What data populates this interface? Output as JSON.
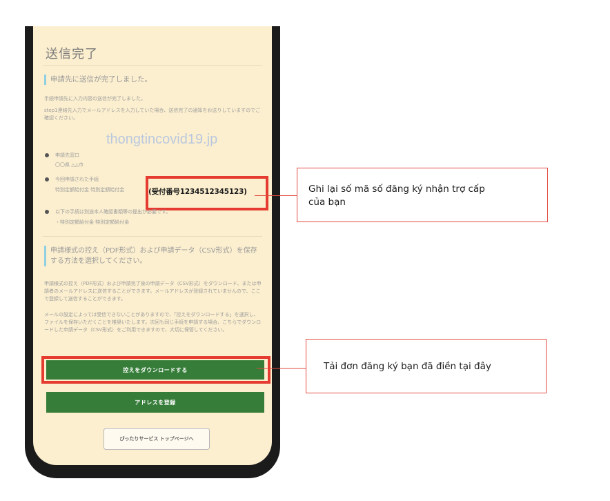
{
  "phone_screen": {
    "title": "送信完了",
    "section1_heading": "申請先に送信が完了しました。",
    "intro_line1": "手続申請先に入力内容の送信が完了しました。",
    "intro_line2": "step1連絡先入力でメールアドレスを入力していた場合、送信完了の通知をお送りしていますのでご確認ください。",
    "watermark": "thongtincovid19.jp",
    "bullets": [
      {
        "line1": "申請先窓口",
        "line2": "〇〇県 △△市"
      },
      {
        "line1": "今回申請された手続",
        "line2": "特別定額給付金 特別定額給付金"
      },
      {
        "line1": "以下の手続は別途本人確認書類等の提出が必要です。",
        "line2": "・特別定額給付金 特別定額給付金"
      }
    ],
    "receipt_number": "(受付番号1234512345123)",
    "section2_heading": "申請様式の控え（PDF形式）および申請データ（CSV形式）を保存する方法を選択してください。",
    "paragraph2": "申請様式の控え（PDF形式）および申請完了後の申請データ（CSV形式）をダウンロード、または申請者のメールアドレスに送信することができます。メールアドレスが登録されていませんので、ここで登録して送信することができます。",
    "paragraph3": "メールの設定によっては受信できないことがありますので、「控えをダウンロードする」を選択し、ファイルを保存いただくことを推奨いたします。次回も同じ手続を申請する場合、こちらでダウンロードした申請データ（CSV形式）をご利用できますので、大切に保管してください。",
    "download_button": "控えをダウンロードする",
    "register_button": "アドレスを登録",
    "top_page_button": "ぴったりサービス トップページへ"
  },
  "callouts": {
    "receipt_note_line1": "Ghi lại số mã số đăng ký nhận trợ cấp",
    "receipt_note_line2": "của bạn",
    "download_note": "Tải đơn đăng ký bạn đã điền tại đây"
  },
  "colors": {
    "screen_bg": "#fcefcf",
    "button_green": "#367d39",
    "highlight_red": "#e53b30",
    "heading_accent": "#8fd0e2"
  }
}
